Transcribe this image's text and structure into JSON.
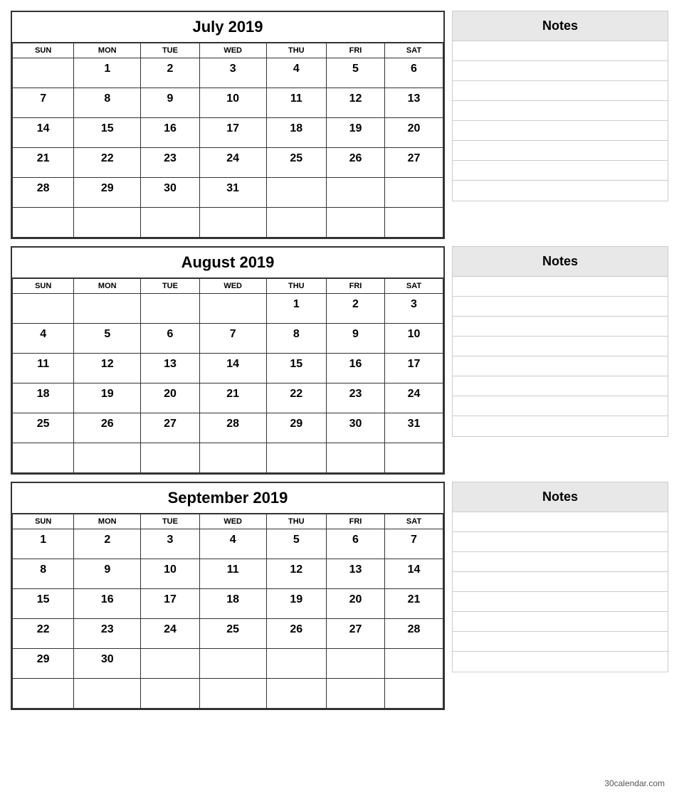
{
  "months": [
    {
      "title": "July 2019",
      "days_header": [
        "SUN",
        "MON",
        "TUE",
        "WED",
        "THU",
        "FRI",
        "SAT"
      ],
      "weeks": [
        [
          "",
          "1",
          "2",
          "3",
          "4",
          "5",
          "6"
        ],
        [
          "7",
          "8",
          "9",
          "10",
          "11",
          "12",
          "13"
        ],
        [
          "14",
          "15",
          "16",
          "17",
          "18",
          "19",
          "20"
        ],
        [
          "21",
          "22",
          "23",
          "24",
          "25",
          "26",
          "27"
        ],
        [
          "28",
          "29",
          "30",
          "31",
          "",
          "",
          ""
        ],
        [
          "",
          "",
          "",
          "",
          "",
          "",
          ""
        ]
      ],
      "notes_label": "Notes"
    },
    {
      "title": "August 2019",
      "days_header": [
        "SUN",
        "MON",
        "TUE",
        "WED",
        "THU",
        "FRI",
        "SAT"
      ],
      "weeks": [
        [
          "",
          "",
          "",
          "",
          "1",
          "2",
          "3"
        ],
        [
          "4",
          "5",
          "6",
          "7",
          "8",
          "9",
          "10"
        ],
        [
          "11",
          "12",
          "13",
          "14",
          "15",
          "16",
          "17"
        ],
        [
          "18",
          "19",
          "20",
          "21",
          "22",
          "23",
          "24"
        ],
        [
          "25",
          "26",
          "27",
          "28",
          "29",
          "30",
          "31"
        ],
        [
          "",
          "",
          "",
          "",
          "",
          "",
          ""
        ]
      ],
      "notes_label": "Notes"
    },
    {
      "title": "September 2019",
      "days_header": [
        "SUN",
        "MON",
        "TUE",
        "WED",
        "THU",
        "FRI",
        "SAT"
      ],
      "weeks": [
        [
          "1",
          "2",
          "3",
          "4",
          "5",
          "6",
          "7"
        ],
        [
          "8",
          "9",
          "10",
          "11",
          "12",
          "13",
          "14"
        ],
        [
          "15",
          "16",
          "17",
          "18",
          "19",
          "20",
          "21"
        ],
        [
          "22",
          "23",
          "24",
          "25",
          "26",
          "27",
          "28"
        ],
        [
          "29",
          "30",
          "",
          "",
          "",
          "",
          ""
        ],
        [
          "",
          "",
          "",
          "",
          "",
          "",
          ""
        ]
      ],
      "notes_label": "Notes"
    }
  ],
  "footer": {
    "text": "30calendar.com"
  }
}
